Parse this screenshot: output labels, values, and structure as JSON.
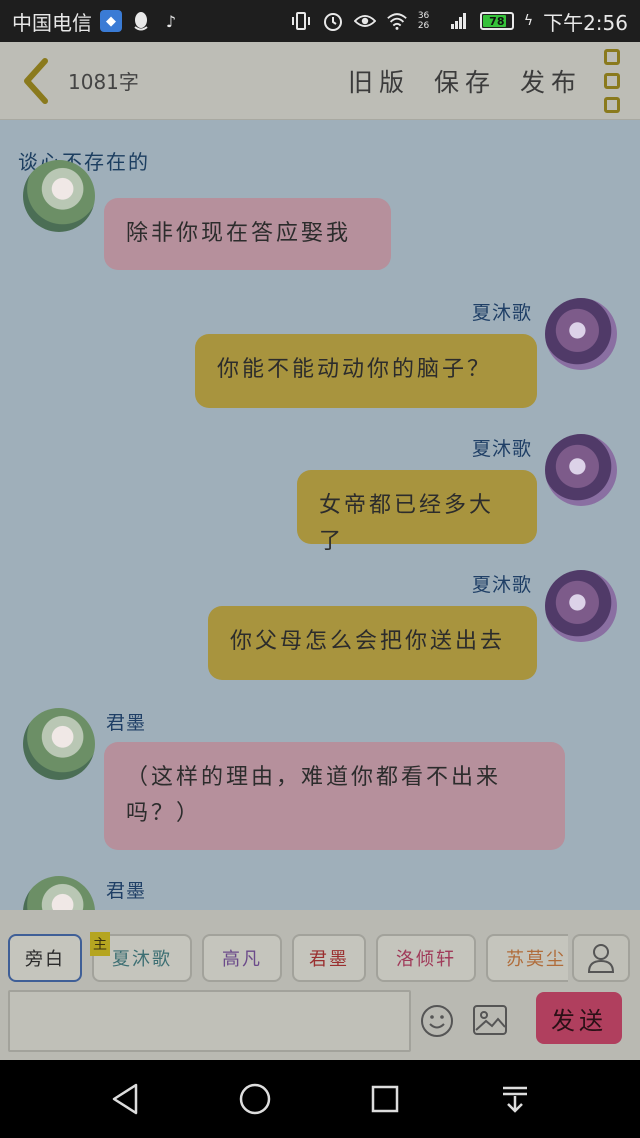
{
  "status_bar": {
    "carrier": "中国电信",
    "time": "下午2:56",
    "battery": "78",
    "signal_text": "36 26",
    "icons": [
      "shield-app-icon",
      "qq-icon",
      "tiktok-icon",
      "vibrate-icon",
      "alarm-icon",
      "eye-icon",
      "wifi-icon",
      "signal-icon",
      "battery-icon",
      "charging-icon"
    ]
  },
  "header": {
    "word_count": "1081字",
    "old_version": "旧版",
    "save": "保存",
    "publish": "发布"
  },
  "chat": {
    "title": "谈心不存在的",
    "messages": [
      {
        "side": "left",
        "sender": "",
        "text": "除非你现在答应娶我",
        "color": "pink"
      },
      {
        "side": "right",
        "sender": "夏沐歌",
        "text": "你能不能动动你的脑子？",
        "color": "gold"
      },
      {
        "side": "right",
        "sender": "夏沐歌",
        "text": "女帝都已经多大了",
        "color": "gold"
      },
      {
        "side": "right",
        "sender": "夏沐歌",
        "text": "你父母怎么会把你送出去",
        "color": "gold"
      },
      {
        "side": "left",
        "sender": "君墨",
        "text": "（这样的理由，难道你都看不出来吗？）",
        "color": "pink"
      },
      {
        "side": "left",
        "sender": "君墨",
        "text": "",
        "color": "pink"
      }
    ]
  },
  "roles": {
    "host_badge": "主",
    "chips": [
      {
        "label": "旁白",
        "color": "#2a2a2a",
        "active": true
      },
      {
        "label": "夏沐歌",
        "color": "#3d6f73",
        "active": false
      },
      {
        "label": "高凡",
        "color": "#6b4a8a",
        "active": false
      },
      {
        "label": "君墨",
        "color": "#9a2f2f",
        "active": false
      },
      {
        "label": "洛倾轩",
        "color": "#a03b5a",
        "active": false
      },
      {
        "label": "苏莫尘",
        "color": "#b06c3a",
        "active": false
      }
    ]
  },
  "composer": {
    "input_value": "",
    "input_placeholder": "",
    "send_label": "发送"
  },
  "colors": {
    "header_bg": "#bdbdb6",
    "chat_bg": "#9fafba",
    "bubble_pink": "#b6909c",
    "bubble_gold": "#a8943e",
    "send": "#b03f5e",
    "name_blue": "#1f3f66"
  }
}
